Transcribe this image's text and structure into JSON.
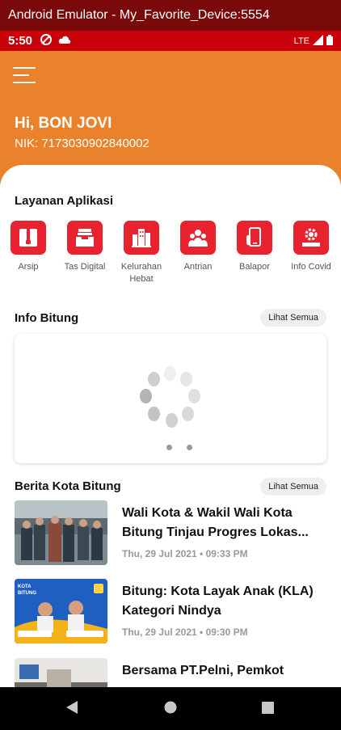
{
  "window_title": "Android Emulator - My_Favorite_Device:5554",
  "status": {
    "time": "5:50",
    "network": "LTE"
  },
  "header": {
    "greeting": "Hi, BON JOVI",
    "nik": "NIK: 7173030902840002"
  },
  "layanan": {
    "title": "Layanan Aplikasi",
    "items": [
      {
        "label": "Arsip",
        "icon": "archive-icon"
      },
      {
        "label": "Tas Digital",
        "icon": "inbox-tray-icon"
      },
      {
        "label": "Kelurahan Hebat",
        "icon": "building-icon"
      },
      {
        "label": "Antrian",
        "icon": "people-queue-icon"
      },
      {
        "label": "Balapor",
        "icon": "phone-report-icon"
      },
      {
        "label": "Info Covid",
        "icon": "covid-gear-icon"
      }
    ]
  },
  "info_bitung": {
    "title": "Info Bitung",
    "see_all": "Lihat Semua"
  },
  "berita": {
    "title": "Berita Kota Bitung",
    "see_all": "Lihat Semua",
    "items": [
      {
        "title": "Wali Kota & Wakil Wali Kota Bitung Tinjau Progres Lokas...",
        "date": "Thu, 29 Jul 2021 • 09:33 PM"
      },
      {
        "title": "Bitung: Kota Layak Anak (KLA) Kategori Nindya",
        "date": "Thu, 29 Jul 2021 • 09:30 PM",
        "thumb_text": "KOTA BITUNG"
      },
      {
        "title": "Bersama PT.Pelni, Pemkot",
        "date": ""
      }
    ]
  },
  "colors": {
    "header": "#e9822a",
    "accent": "#e8222e",
    "status_bar": "#c8000a",
    "title_bar": "#7a0a0a"
  }
}
